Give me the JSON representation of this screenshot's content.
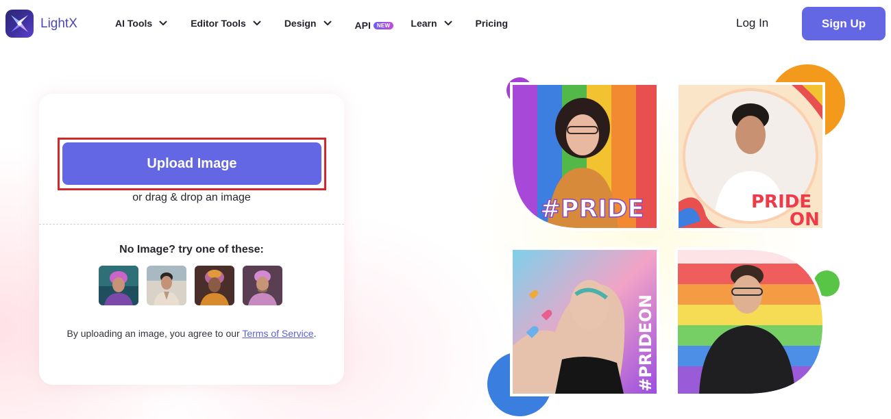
{
  "header": {
    "logo_text": "LightX",
    "nav": [
      {
        "label": "AI Tools",
        "has_dropdown": true
      },
      {
        "label": "Editor Tools",
        "has_dropdown": true
      },
      {
        "label": "Design",
        "has_dropdown": true
      },
      {
        "label": "API",
        "has_dropdown": false,
        "badge": "NEW"
      },
      {
        "label": "Learn",
        "has_dropdown": true
      },
      {
        "label": "Pricing",
        "has_dropdown": false
      }
    ],
    "login_label": "Log In",
    "signup_label": "Sign Up"
  },
  "upload": {
    "button_label": "Upload Image",
    "drag_text": "or drag & drop an image",
    "try_text": "No Image? try one of these:",
    "samples": [
      "sample-1",
      "sample-2",
      "sample-3",
      "sample-4"
    ],
    "terms_prefix": "By uploading an image, you agree to our ",
    "terms_link": "Terms of Service",
    "terms_suffix": "."
  },
  "collage": {
    "tile_1_text": "#PRIDE",
    "tile_2_text_line1": "PRIDE",
    "tile_2_text_line2": "ON",
    "tile_3_text": "#PRIDEON"
  },
  "colors": {
    "accent": "#6467e4",
    "highlight_outline": "#d3272b",
    "link": "#5a5fd6"
  }
}
